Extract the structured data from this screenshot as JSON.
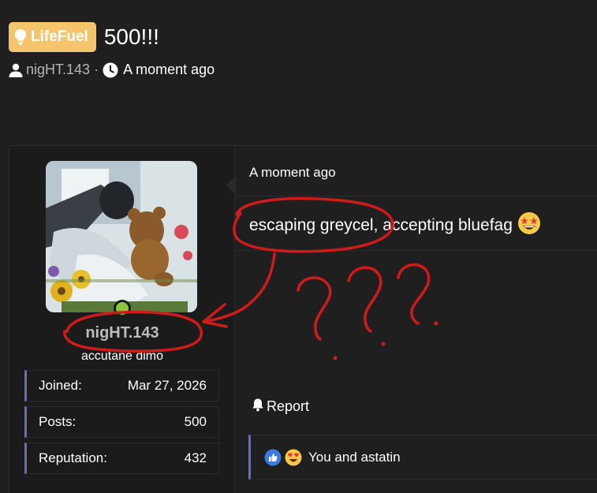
{
  "thread": {
    "prefix": "LifeFuel",
    "prefix_color": "#f5c56b",
    "title": "500!!!",
    "author": "nigHT.143",
    "separator": "·",
    "posted": "A moment ago"
  },
  "user": {
    "username": "nigHT.143",
    "user_title": "accutane dimo",
    "online": true,
    "stats": [
      {
        "label": "Joined:",
        "value": "Mar 27, 2026"
      },
      {
        "label": "Posts:",
        "value": "500"
      },
      {
        "label": "Reputation:",
        "value": "432"
      }
    ]
  },
  "post": {
    "date": "A moment ago",
    "body": "escaping greycel, accepting bluefag",
    "body_emoji": "star-struck-emoji",
    "report_label": "Report",
    "reactions_text": "You and astatin",
    "reaction_icons": [
      "like-icon",
      "heart-eyes-icon"
    ]
  },
  "annotation": {
    "color": "#d11a1a",
    "question_marks": "???"
  },
  "colors": {
    "background": "#1f1f1f",
    "accent": "#6b6bc2",
    "online": "#8ec63f"
  }
}
